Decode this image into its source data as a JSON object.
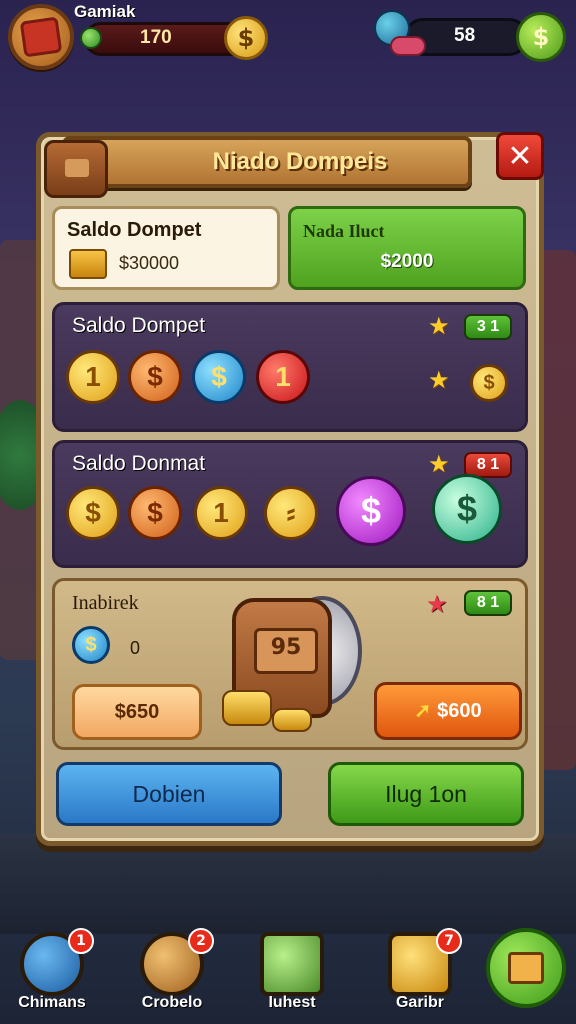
{
  "player": {
    "name": "Gamiak",
    "coins": "170"
  },
  "right_currency": {
    "value": "58"
  },
  "panel": {
    "title": "Niado Dompeis",
    "card_left": {
      "label": "Saldo Dompet",
      "value": "$30000"
    },
    "card_right": {
      "label": "Nada Iluct",
      "value": "$2000"
    },
    "row1": {
      "label": "Saldo Dompet",
      "badge": "3 1",
      "coins": [
        {
          "type": "gold",
          "symbol": "1"
        },
        {
          "type": "orange",
          "symbol": "$"
        },
        {
          "type": "blue",
          "symbol": "$"
        },
        {
          "type": "red",
          "symbol": "1"
        }
      ]
    },
    "row2": {
      "label": "Saldo Donmat",
      "badge": "8 1",
      "coins": [
        {
          "type": "gold",
          "symbol": "$"
        },
        {
          "type": "orange",
          "symbol": "$"
        },
        {
          "type": "gold",
          "symbol": "1"
        },
        {
          "type": "gold",
          "symbol": "⸗"
        },
        {
          "type": "purple",
          "symbol": "$"
        }
      ]
    },
    "row3": {
      "label": "Inabirek",
      "zero": "0",
      "badge": "8 1",
      "price_left": "$650",
      "price_right": "$600",
      "bag_mark": "95"
    },
    "buttons": {
      "left": "Dobien",
      "right": "Ilug 1on"
    }
  },
  "nav": [
    {
      "label": "Chimans",
      "badge": "1"
    },
    {
      "label": "Crobelo",
      "badge": "2"
    },
    {
      "label": "Iuhest",
      "badge": ""
    },
    {
      "label": "Garibr",
      "badge": "7"
    }
  ],
  "colors": {
    "panel_bg": "#cfbd96",
    "row_bg": "#4a3a5e",
    "accent_green": "#4ea21e",
    "accent_blue": "#2a78c8",
    "accent_orange": "#e0560e",
    "close_red": "#b51a12"
  },
  "icons": {
    "avatar": "avatar-icon",
    "coin": "coin-icon",
    "candy": "candy-icon",
    "bag": "bag-icon",
    "close": "close-icon",
    "star": "star-icon",
    "home": "home-icon"
  }
}
